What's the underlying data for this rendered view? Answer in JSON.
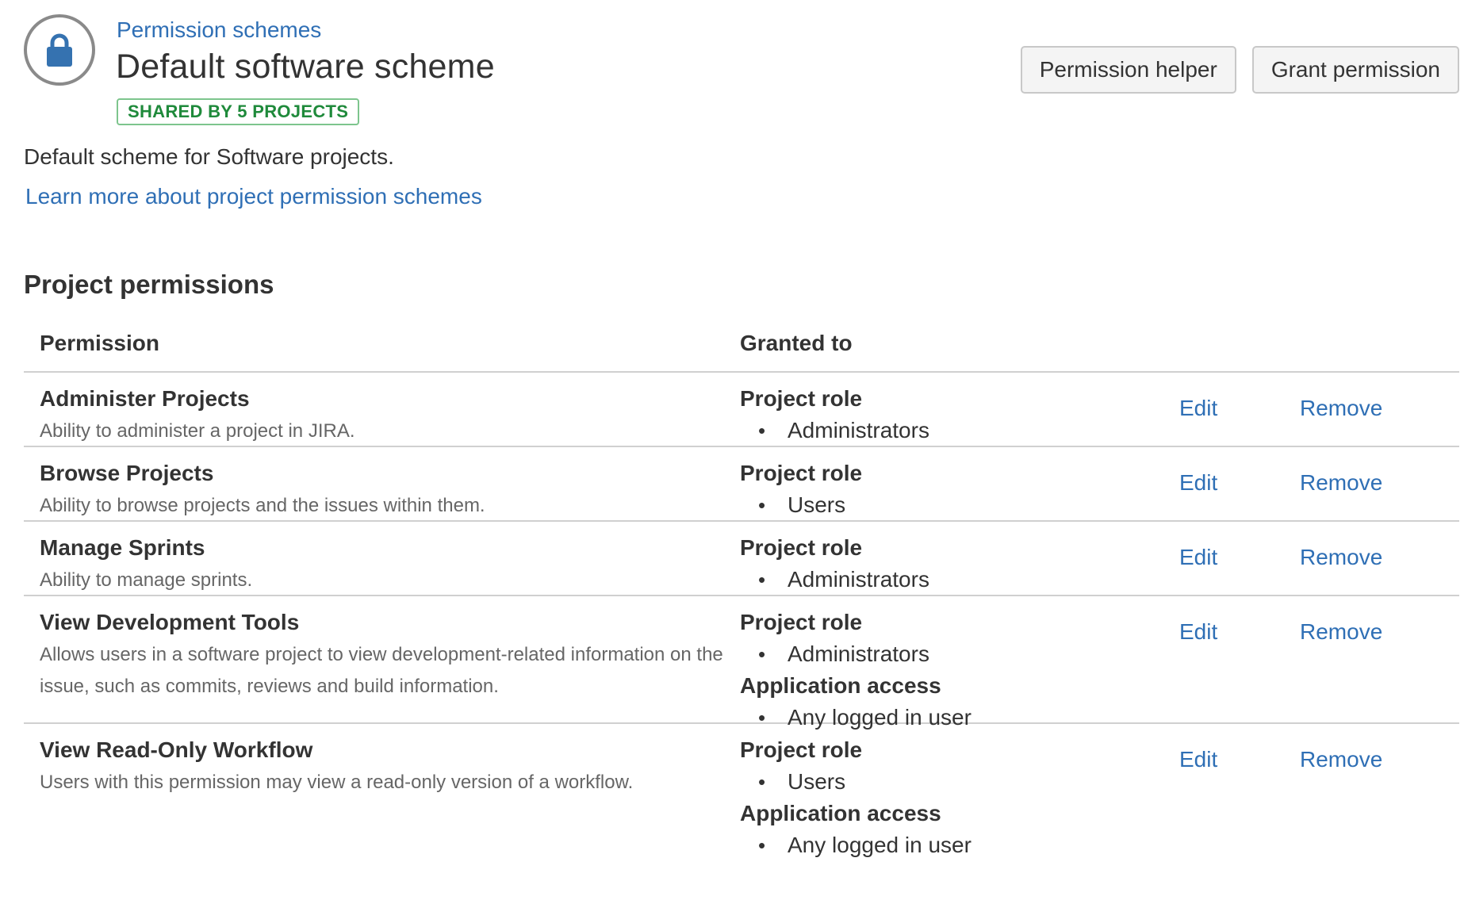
{
  "header": {
    "breadcrumb": "Permission schemes",
    "title": "Default software scheme",
    "badge": "SHARED BY 5 PROJECTS",
    "buttons": {
      "permission_helper": "Permission helper",
      "grant_permission": "Grant permission"
    }
  },
  "description": "Default scheme for Software projects.",
  "learn_more": "Learn more about project permission schemes",
  "section_title": "Project permissions",
  "table": {
    "headers": {
      "permission": "Permission",
      "granted_to": "Granted to"
    },
    "actions": {
      "edit": "Edit",
      "remove": "Remove"
    },
    "rows": [
      {
        "name": "Administer Projects",
        "description": "Ability to administer a project in JIRA.",
        "grants": [
          {
            "type": "Project role",
            "items": [
              "Administrators"
            ]
          }
        ]
      },
      {
        "name": "Browse Projects",
        "description": "Ability to browse projects and the issues within them.",
        "grants": [
          {
            "type": "Project role",
            "items": [
              "Users"
            ]
          }
        ]
      },
      {
        "name": "Manage Sprints",
        "description": "Ability to manage sprints.",
        "grants": [
          {
            "type": "Project role",
            "items": [
              "Administrators"
            ]
          }
        ]
      },
      {
        "name": "View Development Tools",
        "description": "Allows users in a software project to view development-related information on the issue, such as commits, reviews and build information.",
        "grants": [
          {
            "type": "Project role",
            "items": [
              "Administrators"
            ]
          },
          {
            "type": "Application access",
            "items": [
              "Any logged in user"
            ]
          }
        ]
      },
      {
        "name": "View Read-Only Workflow",
        "description": "Users with this permission may view a read-only version of a workflow.",
        "grants": [
          {
            "type": "Project role",
            "items": [
              "Users"
            ]
          },
          {
            "type": "Application access",
            "items": [
              "Any logged in user"
            ]
          }
        ]
      }
    ]
  },
  "colors": {
    "link": "#2f6fb5",
    "badge_text": "#1f8a3b",
    "badge_border": "#7dc58d",
    "lock": "#3572b0"
  }
}
